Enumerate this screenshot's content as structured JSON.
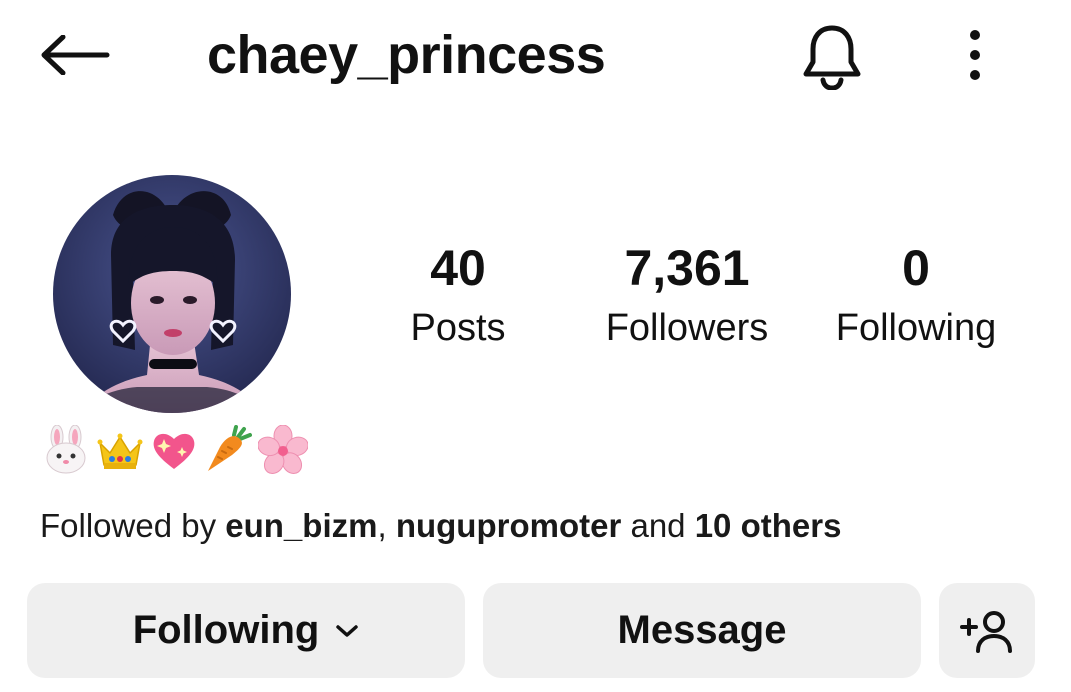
{
  "header": {
    "username": "chaey_princess",
    "back_icon": "arrow-left-icon",
    "bell_icon": "bell-icon",
    "more_icon": "more-vertical-icon"
  },
  "profile": {
    "avatar_icon": "profile-photo"
  },
  "stats": {
    "posts": {
      "value": "40",
      "label": "Posts"
    },
    "followers": {
      "value": "7,361",
      "label": "Followers"
    },
    "following": {
      "value": "0",
      "label": "Following"
    }
  },
  "bio": {
    "emojis": [
      "rabbit-face-icon",
      "crown-icon",
      "sparkling-heart-icon",
      "carrot-icon",
      "cherry-blossom-icon"
    ]
  },
  "followed_by": {
    "prefix": "Followed by ",
    "user1": "eun_bizm",
    "separator": ", ",
    "user2": "nugupromoter",
    "connector": " and ",
    "others": "10 others"
  },
  "actions": {
    "following_label": "Following",
    "message_label": "Message",
    "add_user_icon": "add-user-icon"
  },
  "colors": {
    "button_bg": "#efefef",
    "text": "#111111",
    "background": "#ffffff"
  }
}
